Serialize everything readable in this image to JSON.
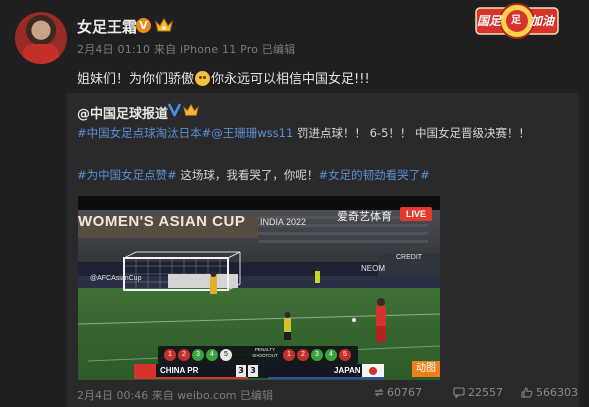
{
  "post": {
    "username": "女足王霜",
    "meta": "2月4日 01:10 来自 iPhone 11 Pro   已编辑",
    "text_before_emoji": "姐妹们！为你们骄傲",
    "text_after_emoji": "你永远可以相信中国女足!!!"
  },
  "fan_badge": {
    "left": "国足",
    "right": "加油",
    "center": "足"
  },
  "repost": {
    "author": "@中国足球报道",
    "line1_link": "#中国女足点球淘汰日本#@王珊珊wss11",
    "line1_text": " 罚进点球！！ 6-5！！ 中国女足晋级决赛！！",
    "line2_link1": "#为中国女足点赞#",
    "line2_text": " 这场球，我看哭了，你呢！",
    "line2_link2": "#女足的韧劲看哭了#",
    "meta": "2月4日 00:46 来自 weibo.com   已编辑",
    "stats": {
      "reposts": "60767",
      "comments": "22557",
      "likes": "566303"
    }
  },
  "video": {
    "banner": "WOMEN'S ASIAN CUP",
    "banner_year": "INDIA 2022",
    "watermark": "爱奇艺体育",
    "live": "LIVE",
    "sponsor_afc": "@AFCAsianCup",
    "sponsor_neom": "NEOM",
    "sponsor_credit": "CREDIT",
    "sponsor_cn": "",
    "penalty_label": "PENALTY SHOOTOUT",
    "team_home": "CHINA PR",
    "team_away": "JAPAN",
    "score_home": "3",
    "score_away": "3",
    "home_kicks": [
      "1",
      "2",
      "3",
      "4",
      "5"
    ],
    "away_kicks": [
      "1",
      "2",
      "3",
      "4",
      "5"
    ],
    "gif_tag": "动图"
  }
}
